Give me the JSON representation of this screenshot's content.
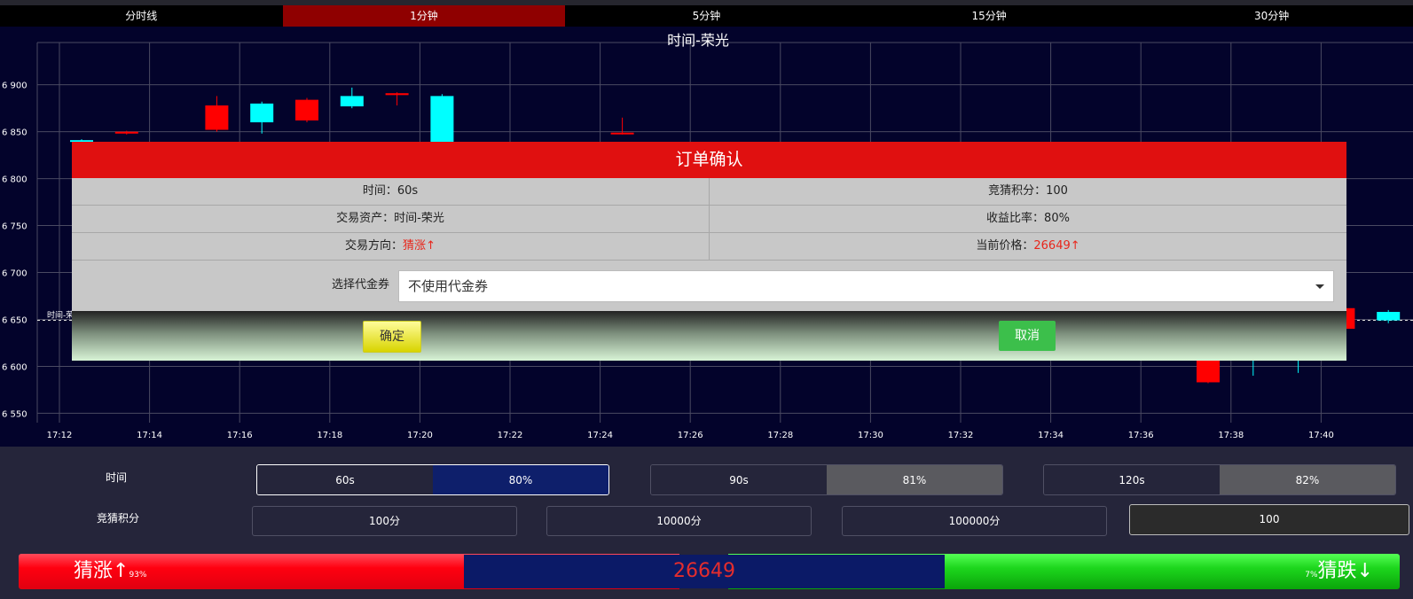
{
  "tabs": [
    "分时线",
    "1分钟",
    "5分钟",
    "15分钟",
    "30分钟"
  ],
  "active_tab": 1,
  "chart": {
    "title": "时间-荣光",
    "y_ticks": [
      "6 900",
      "6 850",
      "6 800",
      "6 750",
      "6 700",
      "6 650",
      "6 600",
      "6 550"
    ],
    "x_ticks": [
      "17:12",
      "17:14",
      "17:16",
      "17:18",
      "17:20",
      "17:22",
      "17:24",
      "17:26",
      "17:28",
      "17:30",
      "17:32",
      "17:34",
      "17:36",
      "17:38",
      "17:40"
    ],
    "price_line_label": "时间-荣",
    "colors": {
      "up": "#ff0000",
      "down": "#00ffff",
      "grid": "#4a4a62",
      "bg": "#03032b"
    }
  },
  "chart_data": {
    "type": "candlestick",
    "title": "时间-荣光",
    "ylim": [
      26540,
      26945
    ],
    "x_ticks": [
      "17:12",
      "17:14",
      "17:16",
      "17:18",
      "17:20",
      "17:22",
      "17:24",
      "17:26",
      "17:28",
      "17:30",
      "17:32",
      "17:34",
      "17:36",
      "17:38",
      "17:40"
    ],
    "candles": [
      {
        "t": "17:12",
        "open": 26841,
        "close": 26840,
        "high": 26842,
        "low": 26839,
        "dir": "down"
      },
      {
        "t": "17:13",
        "open": 26848,
        "close": 26850,
        "high": 26851,
        "low": 26847,
        "dir": "up"
      },
      {
        "t": "17:15",
        "open": 26852,
        "close": 26878,
        "high": 26888,
        "low": 26850,
        "dir": "up"
      },
      {
        "t": "17:16",
        "open": 26880,
        "close": 26860,
        "high": 26882,
        "low": 26848,
        "dir": "down"
      },
      {
        "t": "17:17",
        "open": 26862,
        "close": 26884,
        "high": 26886,
        "low": 26860,
        "dir": "up"
      },
      {
        "t": "17:18",
        "open": 26888,
        "close": 26877,
        "high": 26897,
        "low": 26875,
        "dir": "down"
      },
      {
        "t": "17:19",
        "open": 26889,
        "close": 26891,
        "high": 26892,
        "low": 26878,
        "dir": "up"
      },
      {
        "t": "17:20",
        "open": 26888,
        "close": 26620,
        "high": 26890,
        "low": 26618,
        "dir": "down"
      },
      {
        "t": "17:21",
        "open": 26622,
        "close": 26618,
        "high": 26624,
        "low": 26616,
        "dir": "up"
      },
      {
        "t": "17:24",
        "open": 26848,
        "close": 26849,
        "high": 26865,
        "low": 26847,
        "dir": "up"
      },
      {
        "t": "17:37",
        "open": 26622,
        "close": 26583,
        "high": 26624,
        "low": 26582,
        "dir": "up"
      },
      {
        "t": "17:38",
        "open": 26620,
        "close": 26619,
        "high": 26625,
        "low": 26590,
        "dir": "down"
      },
      {
        "t": "17:39",
        "open": 26625,
        "close": 26624,
        "high": 26626,
        "low": 26593,
        "dir": "down"
      },
      {
        "t": "17:40",
        "open": 26662,
        "close": 26640,
        "high": 26663,
        "low": 26639,
        "dir": "up"
      },
      {
        "t": "17:41",
        "open": 26658,
        "close": 26649,
        "high": 26660,
        "low": 26646,
        "dir": "down"
      }
    ],
    "current_price_line": 26649
  },
  "modal": {
    "title": "订单确认",
    "rows": [
      [
        {
          "label": "时间：",
          "value": "60s"
        },
        {
          "label": "竞猜积分：",
          "value": "100"
        }
      ],
      [
        {
          "label": "交易资产：",
          "value": "时间-荣光"
        },
        {
          "label": "收益比率：",
          "value": "80%"
        }
      ],
      [
        {
          "label": "交易方向：",
          "value": "猜涨",
          "arrow": "↑",
          "red": true
        },
        {
          "label": "当前价格：",
          "value": "26649",
          "arrow": "↑",
          "red": true
        }
      ]
    ],
    "coupon_label": "选择代金券",
    "coupon_value": "不使用代金券",
    "ok_label": "确定",
    "cancel_label": "取消"
  },
  "panel": {
    "time_label": "时间",
    "points_label": "竞猜积分",
    "time_options": [
      {
        "time": "60s",
        "rate": "80%",
        "selected": true
      },
      {
        "time": "90s",
        "rate": "81%",
        "selected": false
      },
      {
        "time": "120s",
        "rate": "82%",
        "selected": false
      }
    ],
    "point_options": [
      "100分",
      "10000分",
      "100000分"
    ],
    "point_input_value": "100"
  },
  "bottom_bar": {
    "up_label": "猜涨",
    "up_arrow": "↑",
    "up_pct": "93%",
    "price": "26649",
    "down_pct": "7%",
    "down_label": "猜跌",
    "down_arrow": "↓"
  }
}
